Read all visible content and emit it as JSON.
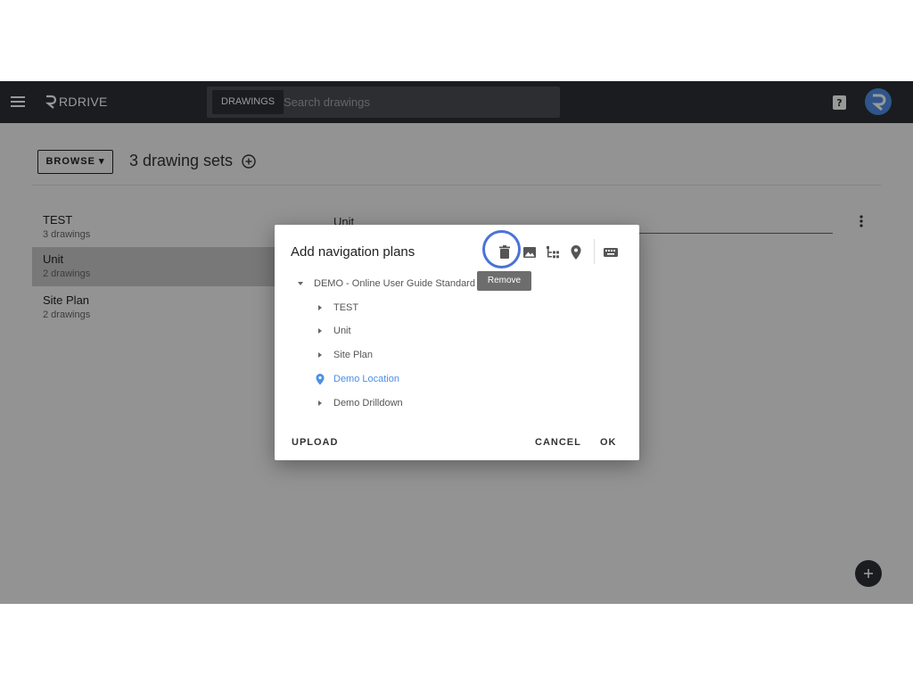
{
  "topbar": {
    "logo_text": "RDRIVE",
    "search_chip": "DRAWINGS",
    "search_placeholder": "Search drawings"
  },
  "toolbar": {
    "browse_label": "BROWSE",
    "title": "3 drawing sets"
  },
  "drawing_sets": [
    {
      "name": "TEST",
      "count": "3 drawings"
    },
    {
      "name": "Unit",
      "count": "2 drawings",
      "selected": true
    },
    {
      "name": "Site Plan",
      "count": "2 drawings"
    }
  ],
  "detail": {
    "name_value": "Unit"
  },
  "dialog": {
    "title": "Add navigation plans",
    "tooltip": "Remove",
    "tree": {
      "root": "DEMO - Online User Guide Standard",
      "children": [
        "TEST",
        "Unit",
        "Site Plan",
        "Demo Location",
        "Demo Drilldown"
      ]
    },
    "upload_label": "UPLOAD",
    "cancel_label": "CANCEL",
    "ok_label": "OK"
  },
  "colors": {
    "topbar": "#2c3035",
    "accent": "#4a8fe8",
    "focus_ring": "#4a73d6"
  }
}
